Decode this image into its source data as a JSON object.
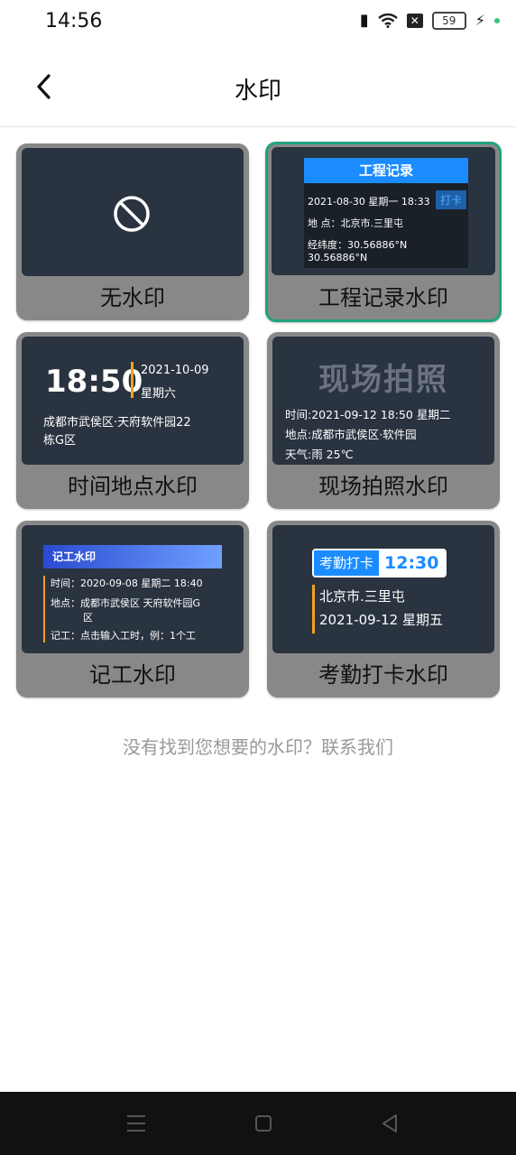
{
  "status": {
    "time": "14:56",
    "battery": "59"
  },
  "header": {
    "title": "水印"
  },
  "cards": [
    {
      "label": "无水印"
    },
    {
      "label": "工程记录水印",
      "title": "工程记录",
      "date": "2021-08-30 星期一 18:33",
      "tag": "打卡",
      "location": "地  点：北京市.三里屯",
      "coords": "经纬度：30.56886°N 30.56886°N"
    },
    {
      "label": "时间地点水印",
      "time": "18:50",
      "date": "2021-10-09",
      "weekday": "星期六",
      "address_line1": "成都市武侯区·天府软件园22",
      "address_line2": "栋G区"
    },
    {
      "label": "现场拍照水印",
      "big_title": "现场拍照",
      "time": "时间:2021-09-12 18:50  星期二",
      "place": "地点:成都市武侯区·软件园",
      "weather": "天气:雨 25℃"
    },
    {
      "label": "记工水印",
      "title": "记工水印",
      "time": "时间：2020-09-08 星期二 18:40",
      "place": "地点：成都市武侯区 天府软件园G",
      "place2": "区",
      "work": "记工：点击输入工时，例：1个工"
    },
    {
      "label": "考勤打卡水印",
      "badge": "考勤打卡",
      "time": "12:30",
      "place": "北京市.三里屯",
      "date": "2021-09-12 星期五"
    }
  ],
  "footer": {
    "text": "没有找到您想要的水印？联系我们"
  },
  "colors": {
    "accent_green": "#1fa37e",
    "blue": "#1a8cff",
    "orange": "#f0a020",
    "dark_preview": "#2a3340"
  }
}
